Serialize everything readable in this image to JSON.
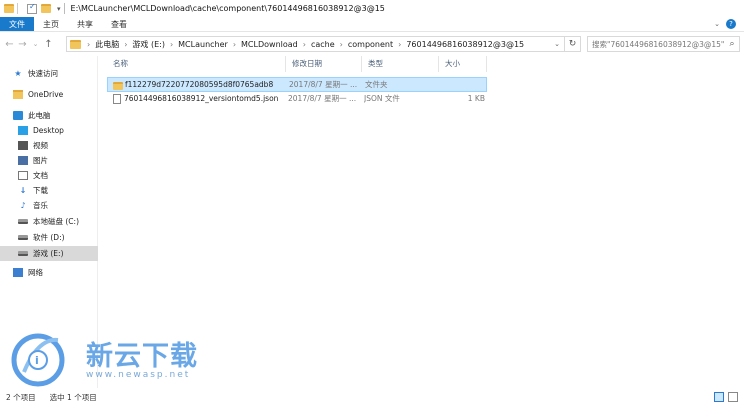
{
  "titlebar": {
    "path": "E:\\MCLauncher\\MCLDownload\\cache\\component\\76014496816038912@3@15"
  },
  "ribbon": {
    "tabs": [
      "文件",
      "主页",
      "共享",
      "查看"
    ]
  },
  "address": {
    "crumbs": [
      "此电脑",
      "游戏 (E:)",
      "MCLauncher",
      "MCLDownload",
      "cache",
      "component",
      "76014496816038912@3@15"
    ],
    "search_placeholder": "搜索\"76014496816038912@3@15\""
  },
  "navpane": {
    "items": [
      {
        "label": "快速访问",
        "icon": "star-icon"
      },
      {
        "label": "OneDrive",
        "icon": "onedrive-icon"
      },
      {
        "label": "此电脑",
        "icon": "pc-icon"
      },
      {
        "label": "Desktop",
        "icon": "desktop-icon"
      },
      {
        "label": "视频",
        "icon": "video-icon"
      },
      {
        "label": "图片",
        "icon": "picture-icon"
      },
      {
        "label": "文档",
        "icon": "document-icon"
      },
      {
        "label": "下载",
        "icon": "download-icon"
      },
      {
        "label": "音乐",
        "icon": "music-icon"
      },
      {
        "label": "本地磁盘 (C:)",
        "icon": "drive-icon"
      },
      {
        "label": "软件 (D:)",
        "icon": "drive-icon"
      },
      {
        "label": "游戏 (E:)",
        "icon": "drive-icon"
      },
      {
        "label": "网络",
        "icon": "network-icon"
      }
    ]
  },
  "filelist": {
    "columns": [
      "名称",
      "修改日期",
      "类型",
      "大小"
    ],
    "rows": [
      {
        "name": "f112279d7220772080595d8f0765adb8",
        "modified": "2017/8/7 星期一 ...",
        "type": "文件夹",
        "size": ""
      },
      {
        "name": "76014496816038912_versiontomd5.json",
        "modified": "2017/8/7 星期一 ...",
        "type": "JSON 文件",
        "size": "1 KB"
      }
    ]
  },
  "watermark": {
    "text": "新云下载",
    "url": "www.newasp.net"
  },
  "statusbar": {
    "count": "2 个项目",
    "selected": "选中 1 个项目"
  },
  "colors": {
    "accent": "#1979ca",
    "selection": "#cce8ff"
  }
}
